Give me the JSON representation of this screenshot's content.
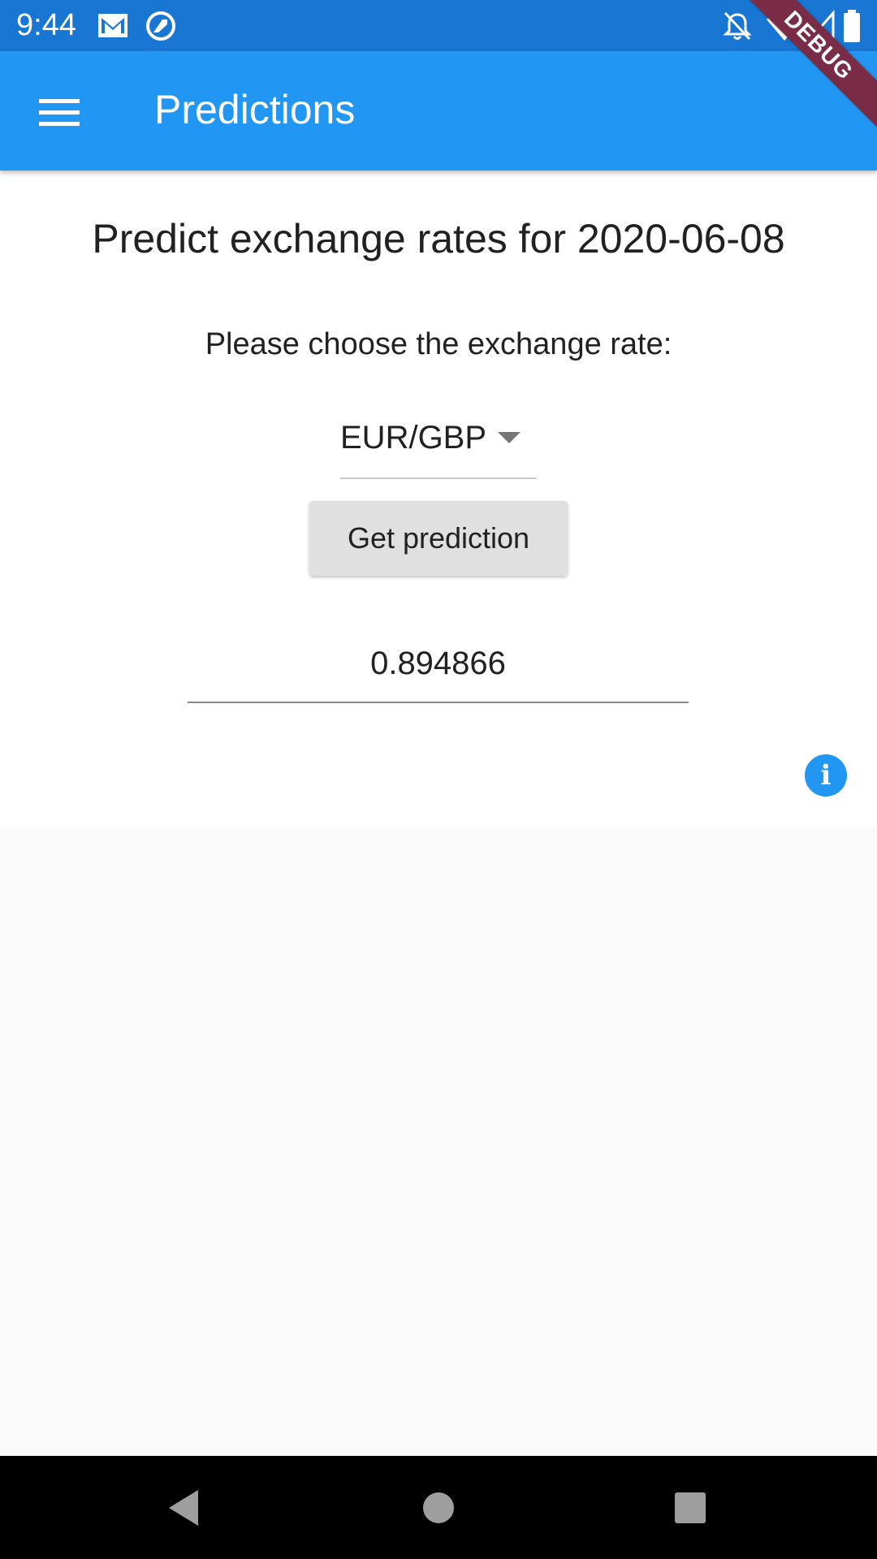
{
  "status_bar": {
    "time": "9:44",
    "left_icons": [
      "gmail-icon",
      "sync-icon"
    ],
    "right_icons": [
      "notifications-off-icon",
      "wifi-icon",
      "cell-signal-icon",
      "battery-icon"
    ]
  },
  "app_bar": {
    "title": "Predictions",
    "menu_icon": "hamburger-menu-icon",
    "background_color": "#2196f3"
  },
  "debug_banner": {
    "label": "DEBUG",
    "color": "#7a2b45"
  },
  "main": {
    "heading": "Predict exchange rates for 2020-06-08",
    "prompt": "Please choose the exchange rate:",
    "rate_dropdown": {
      "selected": "EUR/GBP"
    },
    "predict_button_label": "Get prediction",
    "result_value": "0.894866",
    "info_icon_label": "i"
  },
  "nav_bar": {
    "buttons": [
      "back-icon",
      "home-icon",
      "recents-icon"
    ]
  }
}
